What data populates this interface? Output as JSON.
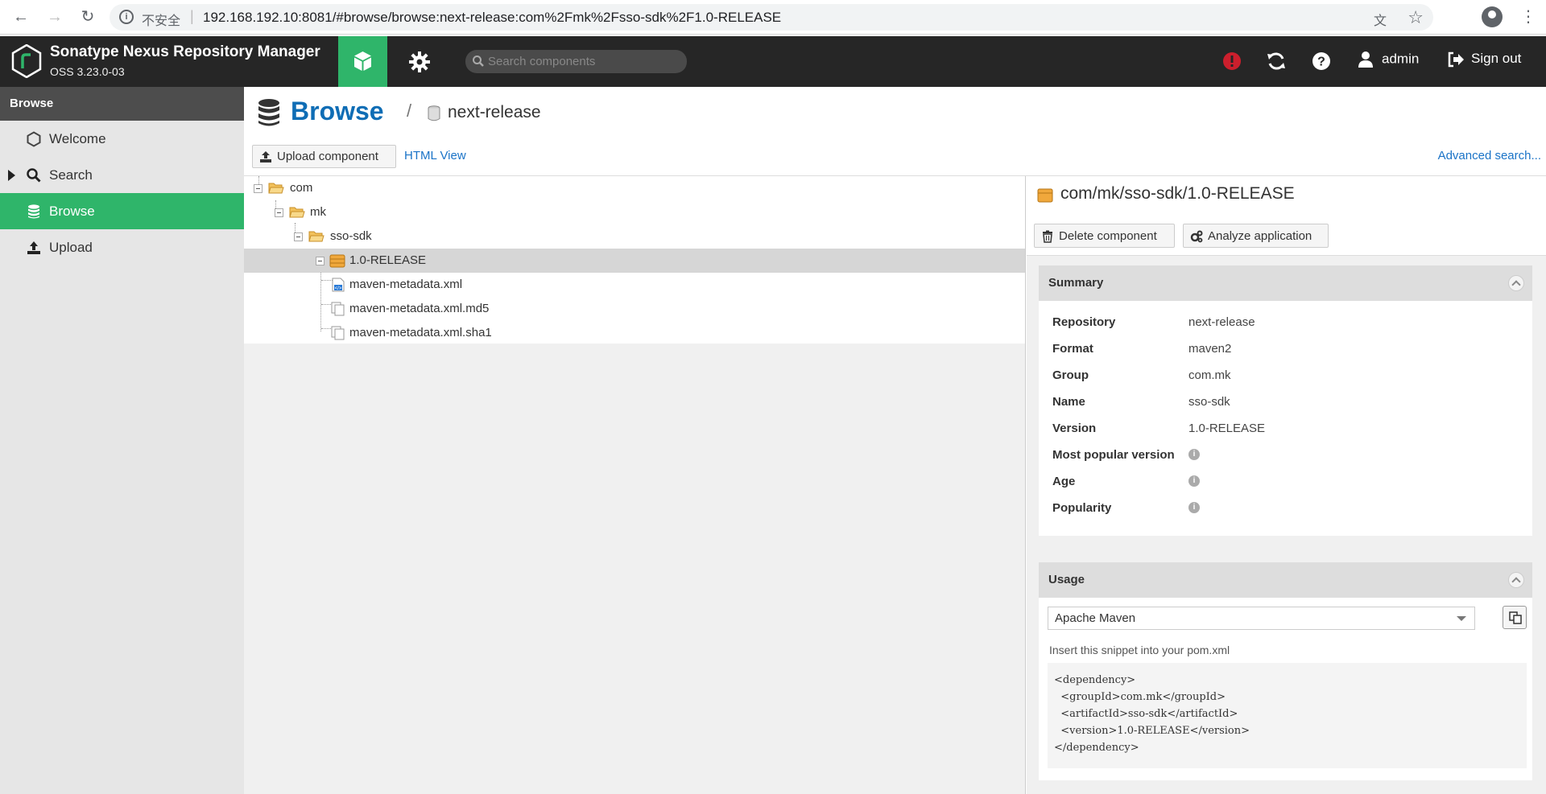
{
  "browser": {
    "insecure_label": "不安全",
    "url": "192.168.192.10:8081/#browse/browse:next-release:com%2Fmk%2Fsso-sdk%2F1.0-RELEASE"
  },
  "header": {
    "app_title": "Sonatype Nexus Repository Manager",
    "version": "OSS 3.23.0-03",
    "search_placeholder": "Search components",
    "user": "admin",
    "sign_out": "Sign out"
  },
  "sidebar": {
    "heading": "Browse",
    "items": [
      {
        "label": "Welcome"
      },
      {
        "label": "Search"
      },
      {
        "label": "Browse"
      },
      {
        "label": "Upload"
      }
    ]
  },
  "main": {
    "title": "Browse",
    "separator": "/",
    "repository": "next-release",
    "upload_button": "Upload component",
    "html_view": "HTML View",
    "advanced_search": "Advanced search..."
  },
  "tree": [
    {
      "label": "com"
    },
    {
      "label": "mk"
    },
    {
      "label": "sso-sdk"
    },
    {
      "label": "1.0-RELEASE"
    },
    {
      "label": "maven-metadata.xml"
    },
    {
      "label": "maven-metadata.xml.md5"
    },
    {
      "label": "maven-metadata.xml.sha1"
    }
  ],
  "detail": {
    "title": "com/mk/sso-sdk/1.0-RELEASE",
    "delete_button": "Delete component",
    "analyze_button": "Analyze application",
    "summary": {
      "heading": "Summary",
      "rows": [
        {
          "key": "Repository",
          "value": "next-release"
        },
        {
          "key": "Format",
          "value": "maven2"
        },
        {
          "key": "Group",
          "value": "com.mk"
        },
        {
          "key": "Name",
          "value": "sso-sdk"
        },
        {
          "key": "Version",
          "value": "1.0-RELEASE"
        },
        {
          "key": "Most popular version",
          "value": ""
        },
        {
          "key": "Age",
          "value": ""
        },
        {
          "key": "Popularity",
          "value": ""
        }
      ]
    },
    "usage": {
      "heading": "Usage",
      "format_selected": "Apache Maven",
      "snippet_label": "Insert this snippet into your pom.xml",
      "snippet": "<dependency>\n  <groupId>com.mk</groupId>\n  <artifactId>sso-sdk</artifactId>\n  <version>1.0-RELEASE</version>\n</dependency>"
    }
  },
  "colors": {
    "header_bg": "#262626",
    "accent_green": "#2fb56a",
    "link_blue": "#1a73c7",
    "alert_red": "#cc1f2d"
  }
}
